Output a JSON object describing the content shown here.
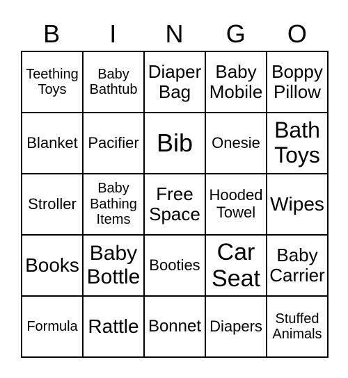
{
  "header": [
    "B",
    "I",
    "N",
    "G",
    "O"
  ],
  "cells": [
    "Teething Toys",
    "Baby Bathtub",
    "Diaper Bag",
    "Baby Mobile",
    "Boppy Pillow",
    "Blanket",
    "Pacifier",
    "Bib",
    "Onesie",
    "Bath Toys",
    "Stroller",
    "Baby Bathing Items",
    "Free Space",
    "Hooded Towel",
    "Wipes",
    "Books",
    "Baby Bottle",
    "Booties",
    "Car Seat",
    "Baby Carrier",
    "Formula",
    "Rattle",
    "Bonnet",
    "Diapers",
    "Stuffed Animals"
  ]
}
